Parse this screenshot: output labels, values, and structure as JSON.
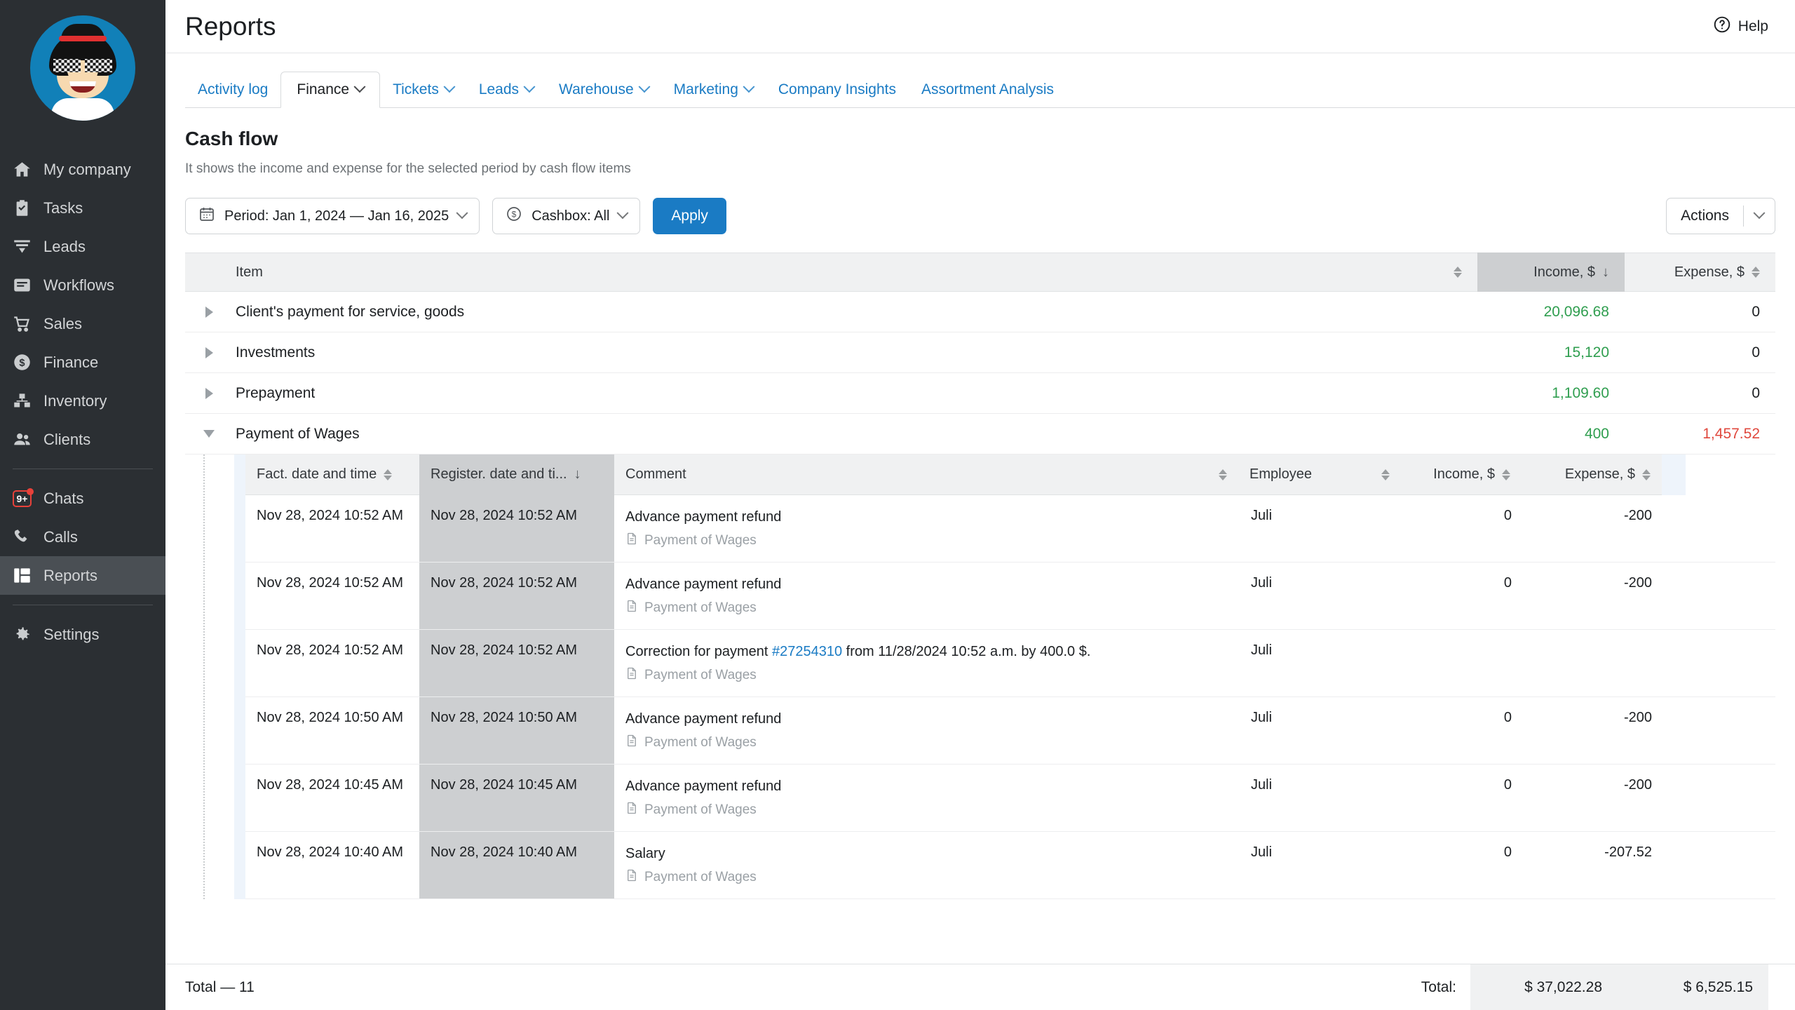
{
  "sidebar": {
    "avatar_alt": "user-avatar",
    "items": [
      {
        "label": "My company",
        "icon": "home-icon",
        "active": false
      },
      {
        "label": "Tasks",
        "icon": "clipboard-check-icon",
        "active": false
      },
      {
        "label": "Leads",
        "icon": "funnel-icon",
        "active": false
      },
      {
        "label": "Workflows",
        "icon": "workflow-icon",
        "active": false
      },
      {
        "label": "Sales",
        "icon": "cart-icon",
        "active": false
      },
      {
        "label": "Finance",
        "icon": "dollar-circle-icon",
        "active": false
      },
      {
        "label": "Inventory",
        "icon": "boxes-icon",
        "active": false
      },
      {
        "label": "Clients",
        "icon": "people-icon",
        "active": false
      },
      {
        "label": "Chats",
        "icon": "chat-badge-icon",
        "active": false,
        "badge": "9+"
      },
      {
        "label": "Calls",
        "icon": "phone-icon",
        "active": false
      },
      {
        "label": "Reports",
        "icon": "reports-icon",
        "active": true
      },
      {
        "label": "Settings",
        "icon": "gear-icon",
        "active": false
      }
    ]
  },
  "header": {
    "title": "Reports",
    "help_label": "Help"
  },
  "tabs": [
    {
      "label": "Activity log",
      "caret": false,
      "active": false
    },
    {
      "label": "Finance",
      "caret": true,
      "active": true
    },
    {
      "label": "Tickets",
      "caret": true,
      "active": false
    },
    {
      "label": "Leads",
      "caret": true,
      "active": false
    },
    {
      "label": "Warehouse",
      "caret": true,
      "active": false
    },
    {
      "label": "Marketing",
      "caret": true,
      "active": false
    },
    {
      "label": "Company Insights",
      "caret": false,
      "active": false
    },
    {
      "label": "Assortment Analysis",
      "caret": false,
      "active": false
    }
  ],
  "report": {
    "title": "Cash flow",
    "subtitle": "It shows the income and expense for the selected period by cash flow items"
  },
  "filters": {
    "period_label": "Period: Jan 1, 2024 — Jan 16, 2025",
    "cashbox_label": "Cashbox: All",
    "apply_label": "Apply",
    "actions_label": "Actions"
  },
  "table": {
    "columns": {
      "item": "Item",
      "income": "Income, $",
      "expense": "Expense, $"
    },
    "sort": {
      "column": "Income, $",
      "direction": "desc"
    },
    "rows": [
      {
        "item": "Client's payment for service, goods",
        "income": "20,096.68",
        "expense": "0",
        "expanded": false
      },
      {
        "item": "Investments",
        "income": "15,120",
        "expense": "0",
        "expanded": false
      },
      {
        "item": "Prepayment",
        "income": "1,109.60",
        "expense": "0",
        "expanded": false
      },
      {
        "item": "Payment of Wages",
        "income": "400",
        "expense": "1,457.52",
        "expanded": true
      }
    ]
  },
  "subtable": {
    "columns": {
      "fact_date": "Fact. date and time",
      "register_date": "Register. date and ti...",
      "comment": "Comment",
      "employee": "Employee",
      "income": "Income, $",
      "expense": "Expense, $"
    },
    "sort": {
      "column": "Register. date and ti...",
      "direction": "desc"
    },
    "rows": [
      {
        "fact_date": "Nov 28, 2024 10:52 AM",
        "register_date": "Nov 28, 2024 10:52 AM",
        "comment_pre": "Advance payment refund",
        "comment_link": "",
        "comment_post": "",
        "comment_tag": "Payment of Wages",
        "employee": "Juli",
        "income": "0",
        "expense": "-200"
      },
      {
        "fact_date": "Nov 28, 2024 10:52 AM",
        "register_date": "Nov 28, 2024 10:52 AM",
        "comment_pre": "Advance payment refund",
        "comment_link": "",
        "comment_post": "",
        "comment_tag": "Payment of Wages",
        "employee": "Juli",
        "income": "0",
        "expense": "-200"
      },
      {
        "fact_date": "Nov 28, 2024 10:52 AM",
        "register_date": "Nov 28, 2024 10:52 AM",
        "comment_pre": "Correction for payment ",
        "comment_link": "#27254310",
        "comment_post": " from 11/28/2024 10:52 a.m. by 400.0 $.",
        "comment_tag": "Payment of Wages",
        "employee": "Juli",
        "income": "",
        "expense": ""
      },
      {
        "fact_date": "Nov 28, 2024 10:50 AM",
        "register_date": "Nov 28, 2024 10:50 AM",
        "comment_pre": "Advance payment refund",
        "comment_link": "",
        "comment_post": "",
        "comment_tag": "Payment of Wages",
        "employee": "Juli",
        "income": "0",
        "expense": "-200"
      },
      {
        "fact_date": "Nov 28, 2024 10:45 AM",
        "register_date": "Nov 28, 2024 10:45 AM",
        "comment_pre": "Advance payment refund",
        "comment_link": "",
        "comment_post": "",
        "comment_tag": "Payment of Wages",
        "employee": "Juli",
        "income": "0",
        "expense": "-200"
      },
      {
        "fact_date": "Nov 28, 2024 10:40 AM",
        "register_date": "Nov 28, 2024 10:40 AM",
        "comment_pre": "Salary",
        "comment_link": "",
        "comment_post": "",
        "comment_tag": "Payment of Wages",
        "employee": "Juli",
        "income": "0",
        "expense": "-207.52"
      }
    ]
  },
  "footer": {
    "total_count_label": "Total — 11",
    "total_label": "Total:",
    "total_income": "$ 37,022.28",
    "total_expense": "$ 6,525.15"
  },
  "colors": {
    "accent": "#1a7bc4",
    "income_green": "#2f9e4f",
    "expense_red": "#e0483d",
    "sidebar_bg": "#2b2f33",
    "badge_red": "#e8413a"
  }
}
